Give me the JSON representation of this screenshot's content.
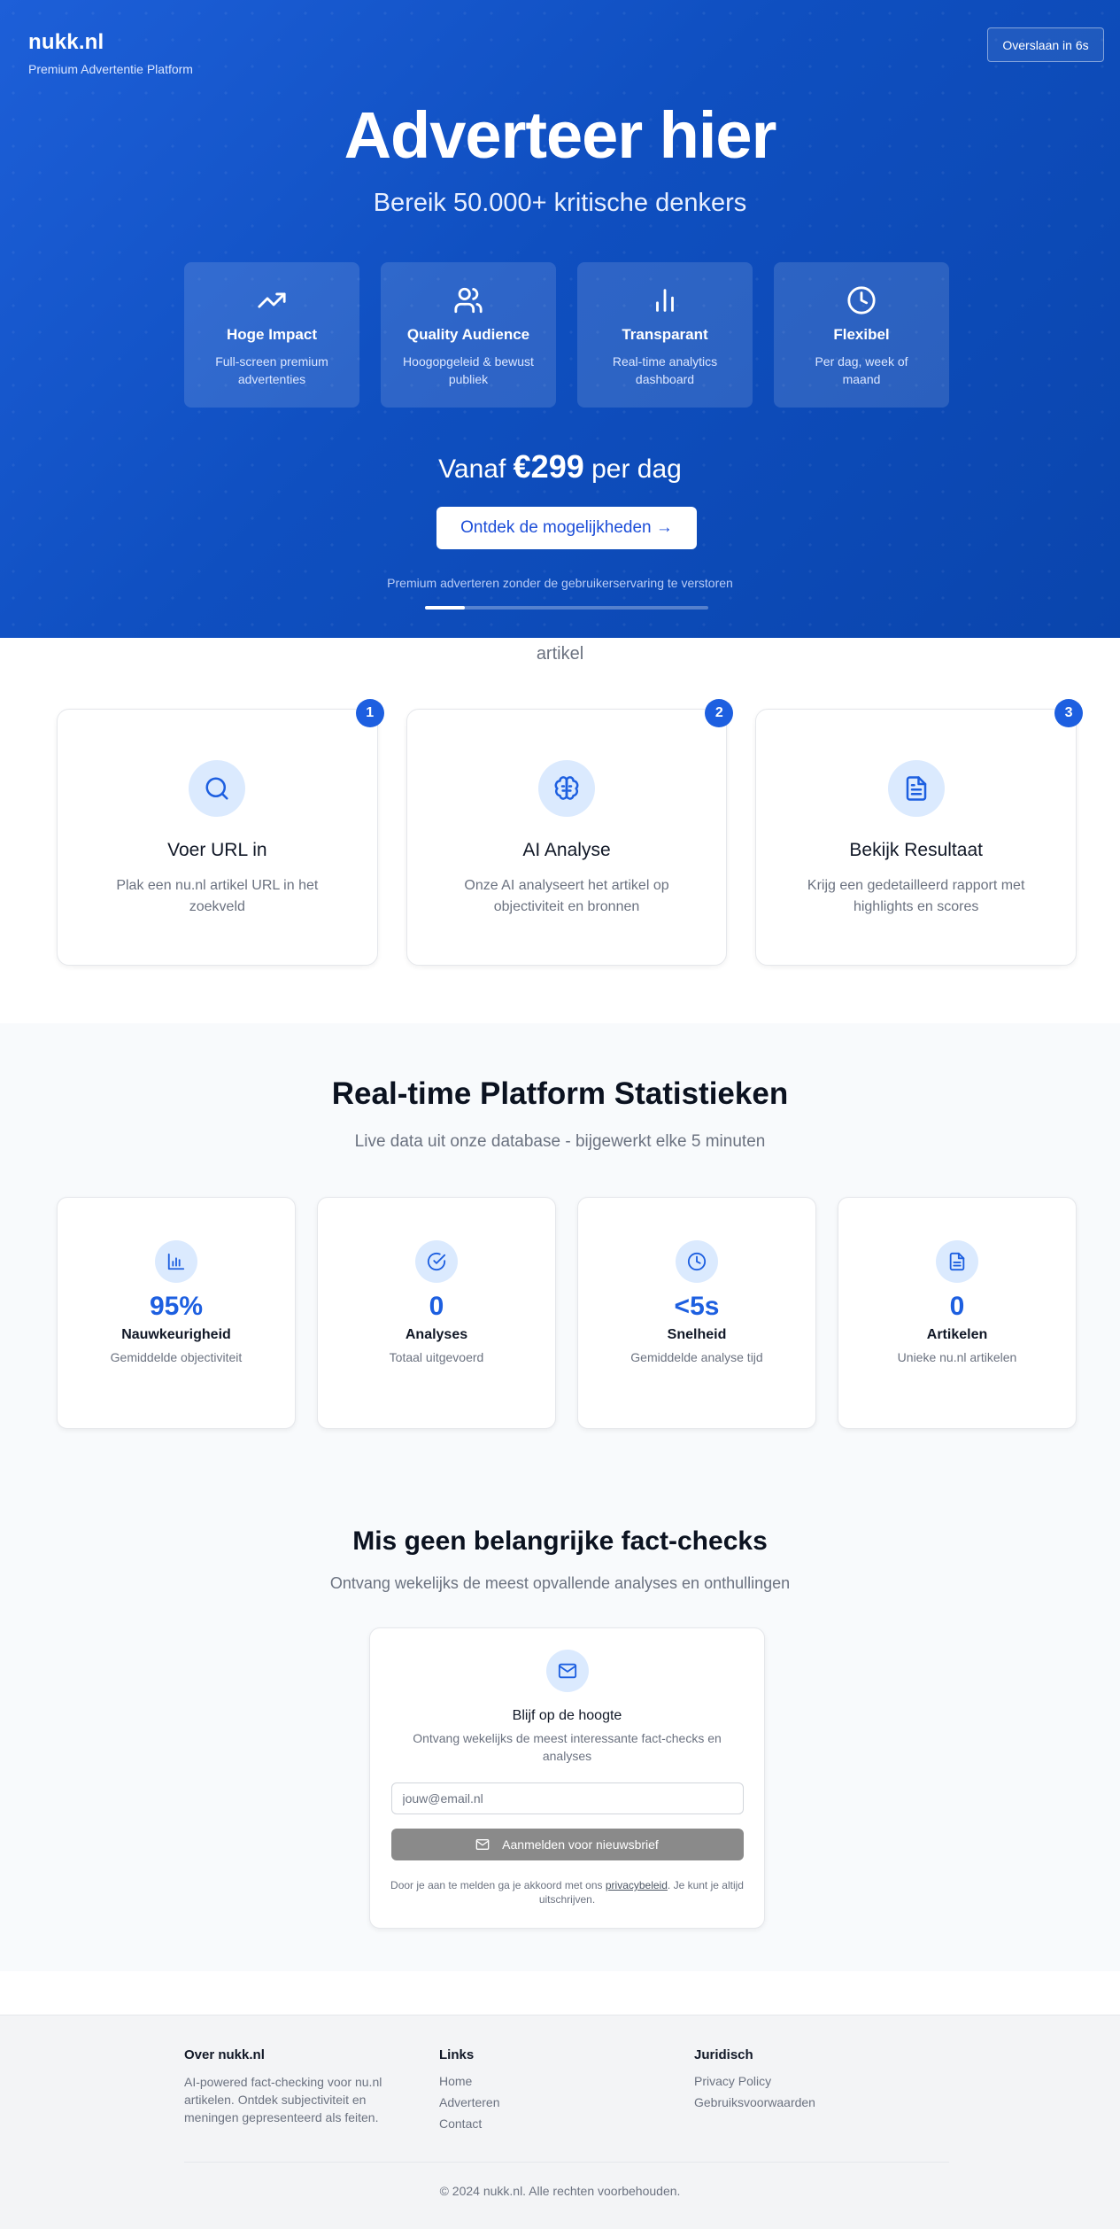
{
  "hero": {
    "brand": "nukk.nl",
    "brand_sub": "Premium Advertentie Platform",
    "skip_label": "Overslaan in 6s",
    "title": "Adverteer hier",
    "subtitle": "Bereik 50.000+ kritische denkers",
    "features": [
      {
        "icon": "trending-up-icon",
        "title": "Hoge Impact",
        "desc": "Full-screen premium advertenties"
      },
      {
        "icon": "users-icon",
        "title": "Quality Audience",
        "desc": "Hoogopgeleid & bewust publiek"
      },
      {
        "icon": "bar-chart-icon",
        "title": "Transparant",
        "desc": "Real-time analytics dashboard"
      },
      {
        "icon": "clock-icon",
        "title": "Flexibel",
        "desc": "Per dag, week of maand"
      }
    ],
    "price_prefix": "Vanaf",
    "price_amount": "€299",
    "price_suffix": "per dag",
    "cta_label": "Ontdek de mogelijkheden →",
    "note": "Premium adverteren zonder de gebruikerservaring te verstoren",
    "progress_fraction": 0.14
  },
  "peek_text": "artikel",
  "steps": [
    {
      "num": "1",
      "icon": "search-icon",
      "title": "Voer URL in",
      "desc": "Plak een nu.nl artikel URL in het zoekveld"
    },
    {
      "num": "2",
      "icon": "brain-icon",
      "title": "AI Analyse",
      "desc": "Onze AI analyseert het artikel op objectiviteit en bronnen"
    },
    {
      "num": "3",
      "icon": "document-icon",
      "title": "Bekijk Resultaat",
      "desc": "Krijg een gedetailleerd rapport met highlights en scores"
    }
  ],
  "stats": {
    "title": "Real-time Platform Statistieken",
    "subtitle": "Live data uit onze database - bijgewerkt elke 5 minuten",
    "items": [
      {
        "icon": "bar-chart-icon",
        "value": "95%",
        "label": "Nauwkeurigheid",
        "desc": "Gemiddelde objectiviteit"
      },
      {
        "icon": "check-circle-icon",
        "value": "0",
        "label": "Analyses",
        "desc": "Totaal uitgevoerd"
      },
      {
        "icon": "clock-icon",
        "value": "<5s",
        "label": "Snelheid",
        "desc": "Gemiddelde analyse tijd"
      },
      {
        "icon": "document-icon",
        "value": "0",
        "label": "Artikelen",
        "desc": "Unieke nu.nl artikelen"
      }
    ]
  },
  "newsletter": {
    "title": "Mis geen belangrijke fact-checks",
    "subtitle": "Ontvang wekelijks de meest opvallende analyses en onthullingen",
    "card_title": "Blijf op de hoogte",
    "card_desc": "Ontvang wekelijks de meest interessante fact-checks en analyses",
    "placeholder": "jouw@email.nl",
    "button_label": "Aanmelden voor nieuwsbrief",
    "legal_prefix": "Door je aan te melden ga je akkoord met ons ",
    "legal_link": "privacybeleid",
    "legal_suffix": ". Je kunt je altijd uitschrijven."
  },
  "footer": {
    "about_title": "Over nukk.nl",
    "about_text": "AI-powered fact-checking voor nu.nl artikelen. Ontdek subjectiviteit en meningen gepresenteerd als feiten.",
    "links_title": "Links",
    "links": [
      "Home",
      "Adverteren",
      "Contact"
    ],
    "legal_title": "Juridisch",
    "legal_links": [
      "Privacy Policy",
      "Gebruiksvoorwaarden"
    ],
    "copyright": "© 2024 nukk.nl. Alle rechten voorbehouden."
  },
  "colors": {
    "hero_blue": "#1d5fd8",
    "accent": "#1d5fe0",
    "icon_bg": "#dbeafe",
    "button_disabled": "#8a8a8a"
  }
}
